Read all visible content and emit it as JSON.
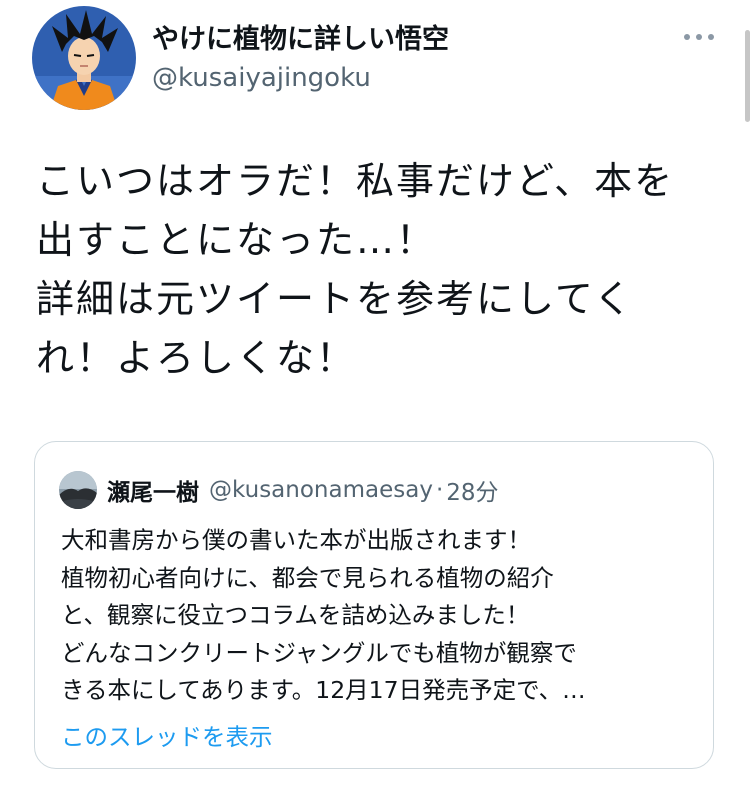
{
  "tweet": {
    "author": {
      "display_name": "やけに植物に詳しい悟空",
      "handle": "@kusaiyajingoku"
    },
    "more_icon": "more-horizontal-icon",
    "text_lines": [
      "こいつはオラだ！私事だけど、本を",
      "出すことになった…！",
      "詳細は元ツイートを参考にしてく",
      "れ！よろしくな！"
    ]
  },
  "quote": {
    "author": {
      "display_name": "瀬尾一樹",
      "handle": "@kusanonamaesay",
      "separator": "·",
      "time": "28分"
    },
    "text_lines": [
      "大和書房から僕の書いた本が出版されます！",
      "植物初心者向けに、都会で見られる植物の紹介",
      "と、観察に役立つコラムを詰め込みました！",
      "どんなコンクリートジャングルでも植物が観察で",
      "きる本にしてあります。12月17日発売予定で、…"
    ],
    "show_thread_label": "このスレッドを表示"
  },
  "colors": {
    "text": "#0f1419",
    "secondary_text": "#536471",
    "link": "#1d9bf0",
    "border": "#cfd9de"
  }
}
